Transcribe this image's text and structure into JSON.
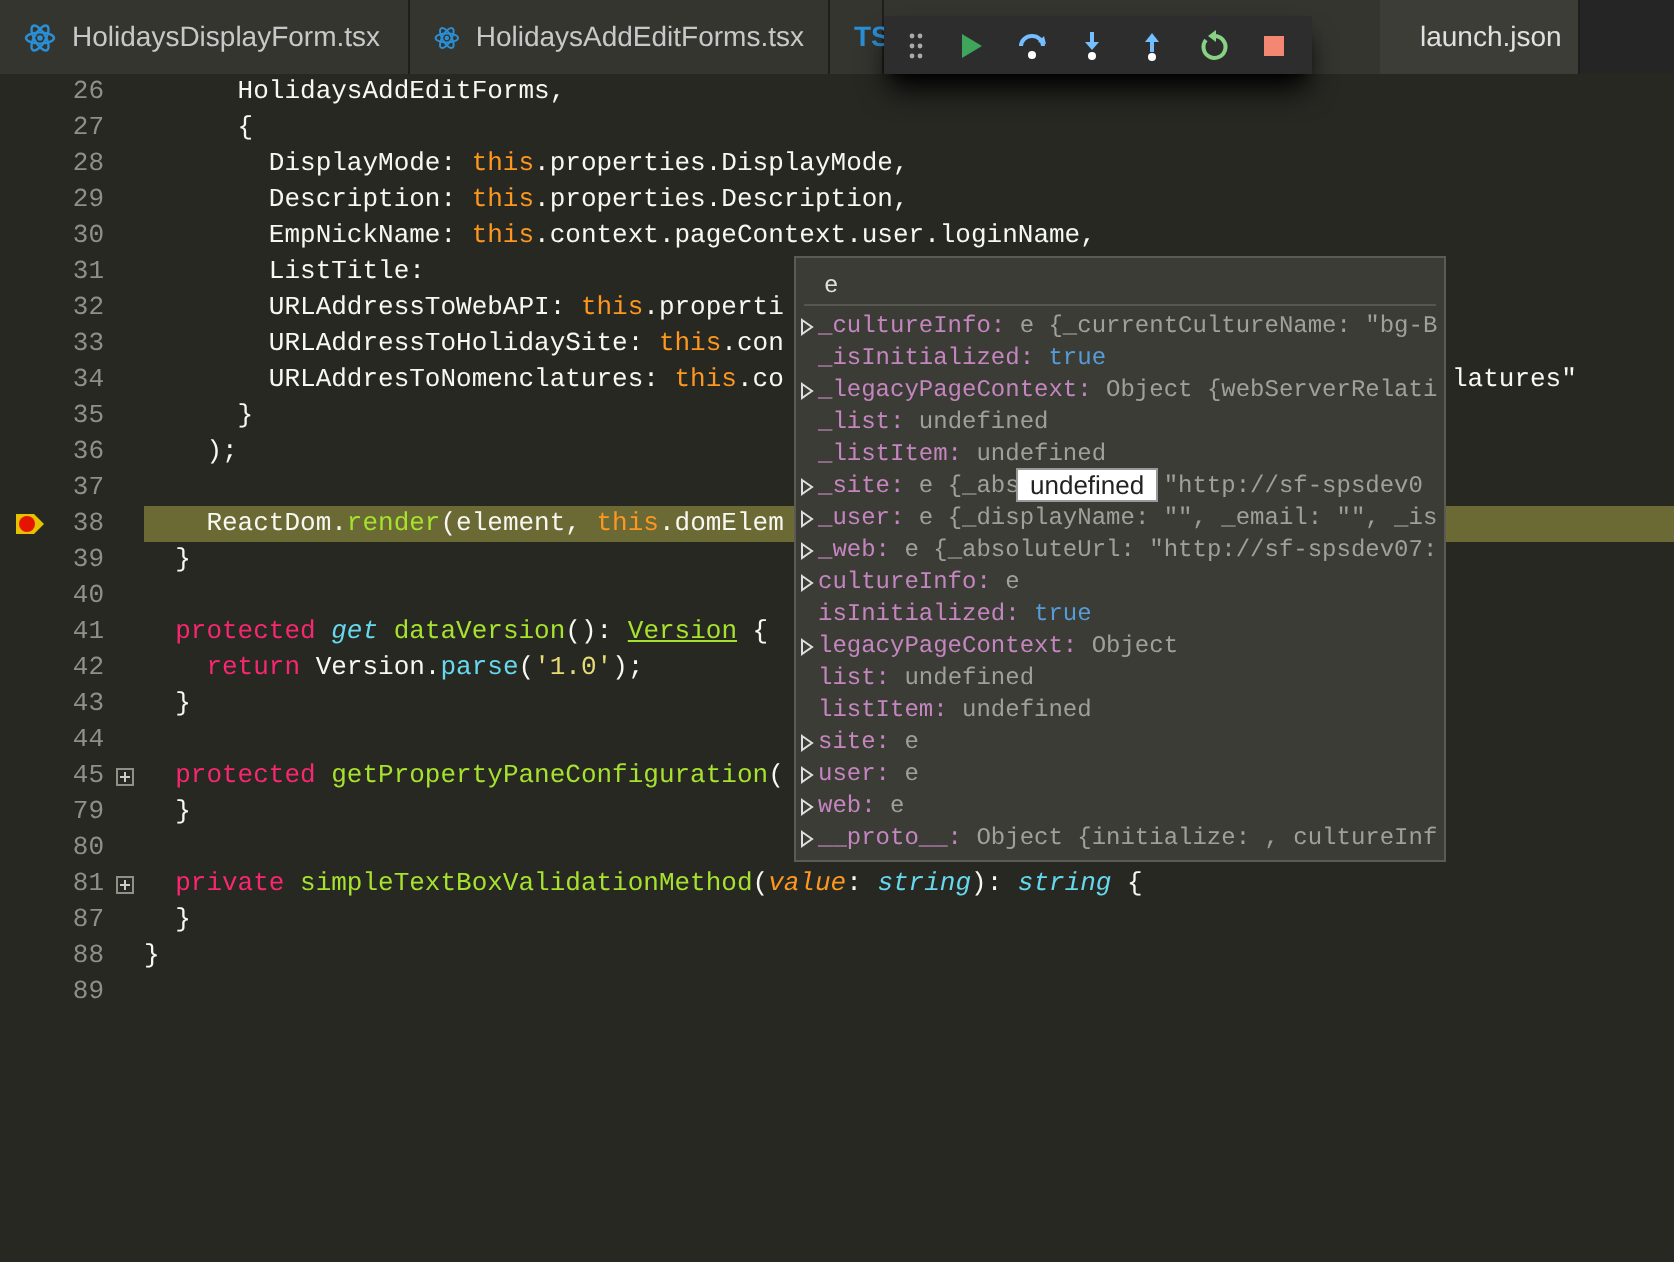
{
  "tabs": [
    {
      "label": "HolidaysDisplayForm.tsx",
      "kind": "component",
      "selected": false
    },
    {
      "label": "HolidaysAddEditForms.tsx",
      "kind": "component",
      "selected": false
    },
    {
      "label": "TS",
      "kind": "badge",
      "selected": false
    },
    {
      "label": "launch.json",
      "kind": "config",
      "selected": true
    }
  ],
  "debug_toolbar": [
    {
      "kind": "grip"
    },
    {
      "kind": "continue"
    },
    {
      "kind": "step-over"
    },
    {
      "kind": "step-into"
    },
    {
      "kind": "step-out"
    },
    {
      "kind": "restart"
    },
    {
      "kind": "stop"
    }
  ],
  "code_lines": [
    {
      "number": "26",
      "segments": [
        {
          "kind": "plain",
          "text": "      HolidaysAddEditForms,"
        }
      ]
    },
    {
      "number": "27",
      "segments": [
        {
          "kind": "plain",
          "text": "      {"
        }
      ]
    },
    {
      "number": "28",
      "segments": [
        {
          "kind": "plain",
          "text": "        DisplayMode: "
        },
        {
          "kind": "this",
          "text": "this"
        },
        {
          "kind": "plain",
          "text": ".properties.DisplayMode,"
        }
      ]
    },
    {
      "number": "29",
      "segments": [
        {
          "kind": "plain",
          "text": "        Description: "
        },
        {
          "kind": "this",
          "text": "this"
        },
        {
          "kind": "plain",
          "text": ".properties.Description,"
        }
      ]
    },
    {
      "number": "30",
      "segments": [
        {
          "kind": "plain",
          "text": "        EmpNickName: "
        },
        {
          "kind": "this",
          "text": "this"
        },
        {
          "kind": "plain",
          "text": ".context.pageContext.user.loginName,"
        }
      ]
    },
    {
      "number": "31",
      "segments": [
        {
          "kind": "plain",
          "text": "        ListTitle:"
        }
      ]
    },
    {
      "number": "32",
      "segments": [
        {
          "kind": "plain",
          "text": "        URLAddressToWebAPI: "
        },
        {
          "kind": "this",
          "text": "this"
        },
        {
          "kind": "plain",
          "text": ".properti"
        }
      ]
    },
    {
      "number": "33",
      "segments": [
        {
          "kind": "plain",
          "text": "        URLAddressToHolidaySite: "
        },
        {
          "kind": "this",
          "text": "this"
        },
        {
          "kind": "plain",
          "text": ".con"
        }
      ]
    },
    {
      "number": "34",
      "segments": [
        {
          "kind": "plain",
          "text": "        URLAddresToNomenclatures: "
        },
        {
          "kind": "this",
          "text": "this"
        },
        {
          "kind": "plain",
          "text": ".co"
        }
      ],
      "tail": "latures\""
    },
    {
      "number": "35",
      "segments": [
        {
          "kind": "plain",
          "text": "      }"
        }
      ]
    },
    {
      "number": "36",
      "segments": [
        {
          "kind": "plain",
          "text": "    );"
        }
      ]
    },
    {
      "number": "37"
    },
    {
      "number": "38",
      "breakpoint": true,
      "current": true,
      "segments": [
        {
          "kind": "plain",
          "text": "    ReactDom."
        },
        {
          "kind": "fn",
          "text": "render"
        },
        {
          "kind": "plain",
          "text": "(element, "
        },
        {
          "kind": "this",
          "text": "this"
        },
        {
          "kind": "plain",
          "text": ".domElem"
        }
      ]
    },
    {
      "number": "39",
      "segments": [
        {
          "kind": "plain",
          "text": "  }"
        }
      ]
    },
    {
      "number": "40"
    },
    {
      "number": "41",
      "segments": [
        {
          "kind": "kw",
          "text": "  protected"
        },
        {
          "kind": "storage",
          "text": " get"
        },
        {
          "kind": "fn",
          "text": " dataVersion"
        },
        {
          "kind": "plain",
          "text": "(): "
        },
        {
          "kind": "type",
          "text": "Version"
        },
        {
          "kind": "plain",
          "text": " {"
        }
      ]
    },
    {
      "number": "42",
      "segments": [
        {
          "kind": "kw",
          "text": "    return"
        },
        {
          "kind": "plain",
          "text": " Version."
        },
        {
          "kind": "method",
          "text": "parse"
        },
        {
          "kind": "plain",
          "text": "("
        },
        {
          "kind": "str",
          "text": "'1.0'"
        },
        {
          "kind": "plain",
          "text": ");"
        }
      ]
    },
    {
      "number": "43",
      "segments": [
        {
          "kind": "plain",
          "text": "  }"
        }
      ]
    },
    {
      "number": "44"
    },
    {
      "number": "45",
      "folded": true,
      "segments": [
        {
          "kind": "kw",
          "text": "  protected"
        },
        {
          "kind": "fn",
          "text": " getPropertyPaneConfiguration"
        },
        {
          "kind": "plain",
          "text": "("
        }
      ]
    },
    {
      "number": "79",
      "segments": [
        {
          "kind": "plain",
          "text": "  }"
        }
      ]
    },
    {
      "number": "80"
    },
    {
      "number": "81",
      "folded": true,
      "segments": [
        {
          "kind": "kw",
          "text": "  private"
        },
        {
          "kind": "fn",
          "text": " simpleTextBoxValidationMethod"
        },
        {
          "kind": "plain",
          "text": "("
        },
        {
          "kind": "param",
          "text": "value"
        },
        {
          "kind": "plain",
          "text": ": "
        },
        {
          "kind": "storage",
          "text": "string"
        },
        {
          "kind": "plain",
          "text": "): "
        },
        {
          "kind": "storage",
          "text": "string"
        },
        {
          "kind": "plain",
          "text": " {"
        }
      ]
    },
    {
      "number": "87",
      "segments": [
        {
          "kind": "plain",
          "text": "  }"
        }
      ]
    },
    {
      "number": "88",
      "segments": [
        {
          "kind": "plain",
          "text": "}"
        }
      ]
    },
    {
      "number": "89"
    }
  ],
  "hover": {
    "title": "e",
    "rows": [
      {
        "expandable": true,
        "key": "_cultureInfo:",
        "value": "e {_currentCultureName: \"bg-B"
      },
      {
        "expandable": false,
        "key": "_isInitialized:",
        "value": "true",
        "kind": "bool"
      },
      {
        "expandable": true,
        "key": "_legacyPageContext:",
        "value": "Object {webServerRelati"
      },
      {
        "expandable": false,
        "key": "_list:",
        "value": "undefined"
      },
      {
        "expandable": false,
        "key": "_listItem:",
        "value": "undefined"
      },
      {
        "expandable": true,
        "key": "_site:",
        "value": "e {_abs",
        "value_after": "\"http://sf-spsdev0"
      },
      {
        "expandable": true,
        "key": "_user:",
        "value": "e {_displayName: \"\", _email: \"\", _is"
      },
      {
        "expandable": true,
        "key": "_web:",
        "value": "e {_absoluteUrl: \"http://sf-spsdev07:"
      },
      {
        "expandable": true,
        "key": "cultureInfo:",
        "value": "e"
      },
      {
        "expandable": false,
        "key": "isInitialized:",
        "value": "true",
        "kind": "bool"
      },
      {
        "expandable": true,
        "key": "legacyPageContext:",
        "value": "Object"
      },
      {
        "expandable": false,
        "key": "list:",
        "value": "undefined"
      },
      {
        "expandable": false,
        "key": "listItem:",
        "value": "undefined"
      },
      {
        "expandable": true,
        "key": "site:",
        "value": "e"
      },
      {
        "expandable": true,
        "key": "user:",
        "value": "e"
      },
      {
        "expandable": true,
        "key": "web:",
        "value": "e"
      },
      {
        "expandable": true,
        "key": "__proto__:",
        "value": "Object {initialize: , cultureInf"
      }
    ]
  },
  "tooltip": "undefined"
}
